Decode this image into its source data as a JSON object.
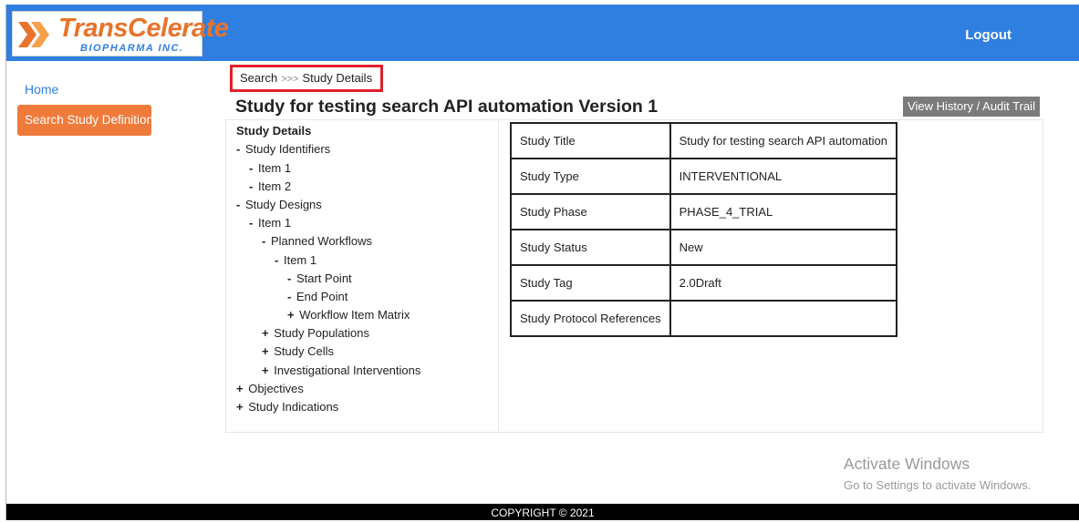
{
  "brand": {
    "name": "TransCelerate",
    "subtitle": "BIOPHARMA INC.",
    "colors": {
      "orange": "#e8732a",
      "blue": "#2f7fe0"
    }
  },
  "header": {
    "logout_label": "Logout",
    "color": "#2f7fe0"
  },
  "sidebar": {
    "home_label": "Home",
    "search_label": "Search Study Definitions"
  },
  "breadcrumb": {
    "items": [
      "Search",
      "Study Details"
    ],
    "separator": ">>>"
  },
  "page": {
    "title": "Study for testing search API automation Version 1",
    "history_button": "View History / Audit Trail"
  },
  "tree": {
    "root": "Study Details",
    "nodes": [
      {
        "marker": "-",
        "label": "Study Identifiers"
      },
      {
        "marker": "-",
        "label": "Item 1"
      },
      {
        "marker": "-",
        "label": "Item 2"
      },
      {
        "marker": "-",
        "label": "Study Designs"
      },
      {
        "marker": "-",
        "label": "Item 1"
      },
      {
        "marker": "-",
        "label": "Planned Workflows"
      },
      {
        "marker": "-",
        "label": "Item 1"
      },
      {
        "marker": "-",
        "label": "Start Point"
      },
      {
        "marker": "-",
        "label": "End Point"
      },
      {
        "marker": "+",
        "label": "Workflow Item Matrix"
      },
      {
        "marker": "+",
        "label": "Study Populations"
      },
      {
        "marker": "+",
        "label": "Study Cells"
      },
      {
        "marker": "+",
        "label": "Investigational Interventions"
      },
      {
        "marker": "+",
        "label": "Objectives"
      },
      {
        "marker": "+",
        "label": "Study Indications"
      }
    ]
  },
  "details": {
    "rows": [
      {
        "key": "Study Title",
        "value": "Study for testing search API automation"
      },
      {
        "key": "Study Type",
        "value": "INTERVENTIONAL"
      },
      {
        "key": "Study Phase",
        "value": "PHASE_4_TRIAL"
      },
      {
        "key": "Study Status",
        "value": "New"
      },
      {
        "key": "Study Tag",
        "value": "2.0Draft"
      },
      {
        "key": "Study Protocol References",
        "value": ""
      }
    ]
  },
  "watermark": {
    "line1": "Activate Windows",
    "line2": "Go to Settings to activate Windows."
  },
  "footer": {
    "copyright": "COPYRIGHT © 2021"
  }
}
